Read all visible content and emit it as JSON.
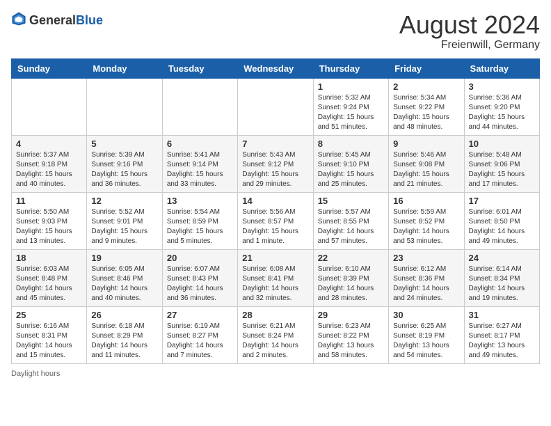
{
  "header": {
    "logo_general": "General",
    "logo_blue": "Blue",
    "month_year": "August 2024",
    "location": "Freienwill, Germany"
  },
  "days_of_week": [
    "Sunday",
    "Monday",
    "Tuesday",
    "Wednesday",
    "Thursday",
    "Friday",
    "Saturday"
  ],
  "weeks": [
    [
      {
        "day": "",
        "info": ""
      },
      {
        "day": "",
        "info": ""
      },
      {
        "day": "",
        "info": ""
      },
      {
        "day": "",
        "info": ""
      },
      {
        "day": "1",
        "info": "Sunrise: 5:32 AM\nSunset: 9:24 PM\nDaylight: 15 hours and 51 minutes."
      },
      {
        "day": "2",
        "info": "Sunrise: 5:34 AM\nSunset: 9:22 PM\nDaylight: 15 hours and 48 minutes."
      },
      {
        "day": "3",
        "info": "Sunrise: 5:36 AM\nSunset: 9:20 PM\nDaylight: 15 hours and 44 minutes."
      }
    ],
    [
      {
        "day": "4",
        "info": "Sunrise: 5:37 AM\nSunset: 9:18 PM\nDaylight: 15 hours and 40 minutes."
      },
      {
        "day": "5",
        "info": "Sunrise: 5:39 AM\nSunset: 9:16 PM\nDaylight: 15 hours and 36 minutes."
      },
      {
        "day": "6",
        "info": "Sunrise: 5:41 AM\nSunset: 9:14 PM\nDaylight: 15 hours and 33 minutes."
      },
      {
        "day": "7",
        "info": "Sunrise: 5:43 AM\nSunset: 9:12 PM\nDaylight: 15 hours and 29 minutes."
      },
      {
        "day": "8",
        "info": "Sunrise: 5:45 AM\nSunset: 9:10 PM\nDaylight: 15 hours and 25 minutes."
      },
      {
        "day": "9",
        "info": "Sunrise: 5:46 AM\nSunset: 9:08 PM\nDaylight: 15 hours and 21 minutes."
      },
      {
        "day": "10",
        "info": "Sunrise: 5:48 AM\nSunset: 9:06 PM\nDaylight: 15 hours and 17 minutes."
      }
    ],
    [
      {
        "day": "11",
        "info": "Sunrise: 5:50 AM\nSunset: 9:03 PM\nDaylight: 15 hours and 13 minutes."
      },
      {
        "day": "12",
        "info": "Sunrise: 5:52 AM\nSunset: 9:01 PM\nDaylight: 15 hours and 9 minutes."
      },
      {
        "day": "13",
        "info": "Sunrise: 5:54 AM\nSunset: 8:59 PM\nDaylight: 15 hours and 5 minutes."
      },
      {
        "day": "14",
        "info": "Sunrise: 5:56 AM\nSunset: 8:57 PM\nDaylight: 15 hours and 1 minute."
      },
      {
        "day": "15",
        "info": "Sunrise: 5:57 AM\nSunset: 8:55 PM\nDaylight: 14 hours and 57 minutes."
      },
      {
        "day": "16",
        "info": "Sunrise: 5:59 AM\nSunset: 8:52 PM\nDaylight: 14 hours and 53 minutes."
      },
      {
        "day": "17",
        "info": "Sunrise: 6:01 AM\nSunset: 8:50 PM\nDaylight: 14 hours and 49 minutes."
      }
    ],
    [
      {
        "day": "18",
        "info": "Sunrise: 6:03 AM\nSunset: 8:48 PM\nDaylight: 14 hours and 45 minutes."
      },
      {
        "day": "19",
        "info": "Sunrise: 6:05 AM\nSunset: 8:46 PM\nDaylight: 14 hours and 40 minutes."
      },
      {
        "day": "20",
        "info": "Sunrise: 6:07 AM\nSunset: 8:43 PM\nDaylight: 14 hours and 36 minutes."
      },
      {
        "day": "21",
        "info": "Sunrise: 6:08 AM\nSunset: 8:41 PM\nDaylight: 14 hours and 32 minutes."
      },
      {
        "day": "22",
        "info": "Sunrise: 6:10 AM\nSunset: 8:39 PM\nDaylight: 14 hours and 28 minutes."
      },
      {
        "day": "23",
        "info": "Sunrise: 6:12 AM\nSunset: 8:36 PM\nDaylight: 14 hours and 24 minutes."
      },
      {
        "day": "24",
        "info": "Sunrise: 6:14 AM\nSunset: 8:34 PM\nDaylight: 14 hours and 19 minutes."
      }
    ],
    [
      {
        "day": "25",
        "info": "Sunrise: 6:16 AM\nSunset: 8:31 PM\nDaylight: 14 hours and 15 minutes."
      },
      {
        "day": "26",
        "info": "Sunrise: 6:18 AM\nSunset: 8:29 PM\nDaylight: 14 hours and 11 minutes."
      },
      {
        "day": "27",
        "info": "Sunrise: 6:19 AM\nSunset: 8:27 PM\nDaylight: 14 hours and 7 minutes."
      },
      {
        "day": "28",
        "info": "Sunrise: 6:21 AM\nSunset: 8:24 PM\nDaylight: 14 hours and 2 minutes."
      },
      {
        "day": "29",
        "info": "Sunrise: 6:23 AM\nSunset: 8:22 PM\nDaylight: 13 hours and 58 minutes."
      },
      {
        "day": "30",
        "info": "Sunrise: 6:25 AM\nSunset: 8:19 PM\nDaylight: 13 hours and 54 minutes."
      },
      {
        "day": "31",
        "info": "Sunrise: 6:27 AM\nSunset: 8:17 PM\nDaylight: 13 hours and 49 minutes."
      }
    ]
  ],
  "footer": {
    "daylight_label": "Daylight hours"
  }
}
